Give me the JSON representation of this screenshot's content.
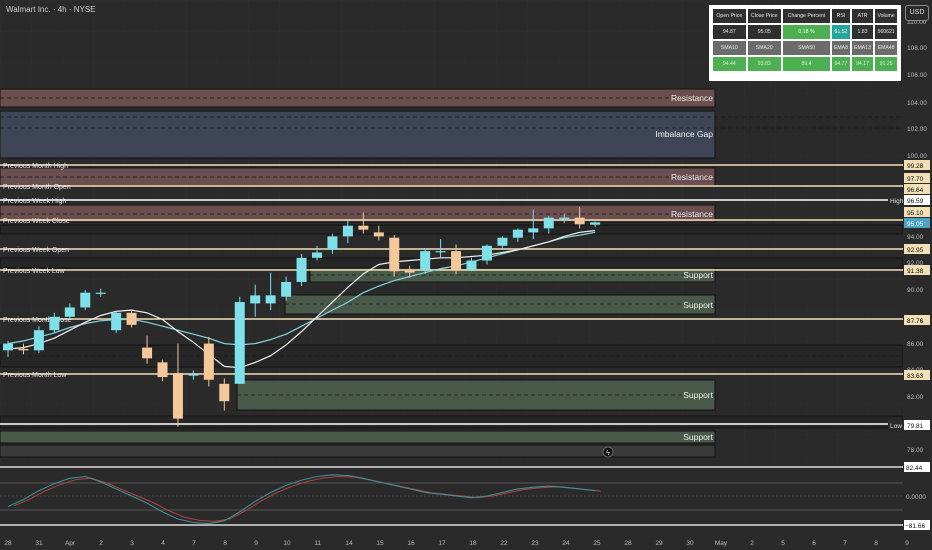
{
  "header": {
    "title": "Walmart Inc. · 4h · NYSE",
    "currency_button": "USD"
  },
  "stats_table": {
    "row1_headers": [
      "Open Price",
      "Close Price",
      "Change Percent",
      "RSI",
      "ATR",
      "Volume"
    ],
    "row1_values": [
      "94.87",
      "95.05",
      "0.18 %",
      "61.52",
      "1.83",
      "560621"
    ],
    "row2_headers": [
      "SMA10",
      "SMA20",
      "SMA50",
      "EMA8",
      "EMA13",
      "EMA48"
    ],
    "row2_values": [
      "94.44",
      "93.83",
      "89.4",
      "94.77",
      "94.17",
      "91.25"
    ]
  },
  "zone_labels": {
    "resistance_top": "Resistance",
    "imbalance": "Imbalance Gap",
    "resistance_mid": "Resistance",
    "resistance_low": "Resistance",
    "support_1": "Support",
    "support_2": "Support",
    "support_3": "Support",
    "support_4": "Support"
  },
  "level_labels": [
    "Previous Month High",
    "Previous Month Open",
    "Previous Week High",
    "Previous Week Close",
    "Previous Week Open",
    "Previous Week Low",
    "Previous Month Close",
    "Previous Month Low"
  ],
  "price_axis": [
    "108.00",
    "106.00",
    "104.00",
    "102.00",
    "100.00",
    "94.00",
    "92.00",
    "90.00",
    "88.00",
    "86.00",
    "84.00",
    "82.00",
    "78.00",
    "110.00"
  ],
  "price_tags": {
    "t9928": "99.28",
    "t9770": "97.70",
    "t9664": "96.64",
    "t9659": "96.59",
    "t9510": "95.10",
    "t9505": "95.05",
    "t9295": "92.95",
    "t9138": "91.38",
    "t8776": "87.76",
    "t8363": "83.63",
    "t7981": "79.81"
  },
  "high_label": "High",
  "low_label": "Low",
  "oscillator_axis": {
    "top": "82.44",
    "mid": "0.0000",
    "bottom": "−81.66"
  },
  "time_axis": [
    "28",
    "31",
    "Apr",
    "2",
    "3",
    "4",
    "7",
    "8",
    "9",
    "10",
    "11",
    "14",
    "15",
    "16",
    "17",
    "18",
    "22",
    "23",
    "24",
    "25",
    "28",
    "29",
    "30",
    "May",
    "2",
    "5",
    "6",
    "7",
    "8",
    "9"
  ],
  "colors": {
    "bull": "#7ee0e8",
    "bear": "#f5c89a",
    "resistance": "#6a4f4e",
    "support": "#4a5a4a",
    "imbalance": "#3e4556",
    "level_line": "#f3dfb6",
    "sma_fast": "#f0f0f0",
    "sma_slow": "#86d5dd"
  },
  "chart_data": {
    "type": "candlestick",
    "timeframe": "4h",
    "candles": [
      {
        "o": 85.5,
        "h": 86.2,
        "l": 85.0,
        "c": 86.0
      },
      {
        "o": 85.6,
        "h": 86.0,
        "l": 85.2,
        "c": 85.5
      },
      {
        "o": 85.5,
        "h": 87.3,
        "l": 85.3,
        "c": 87.0
      },
      {
        "o": 87.0,
        "h": 88.3,
        "l": 86.8,
        "c": 88.0
      },
      {
        "o": 88.0,
        "h": 89.0,
        "l": 87.8,
        "c": 88.7
      },
      {
        "o": 88.7,
        "h": 90.0,
        "l": 88.5,
        "c": 89.8
      },
      {
        "o": 89.8,
        "h": 90.1,
        "l": 89.5,
        "c": 89.8
      },
      {
        "o": 87.0,
        "h": 88.4,
        "l": 86.8,
        "c": 88.3
      },
      {
        "o": 88.3,
        "h": 88.5,
        "l": 87.2,
        "c": 87.4
      },
      {
        "o": 85.7,
        "h": 86.6,
        "l": 84.5,
        "c": 84.9
      },
      {
        "o": 84.6,
        "h": 84.8,
        "l": 83.2,
        "c": 83.5
      },
      {
        "o": 83.8,
        "h": 86.0,
        "l": 79.8,
        "c": 80.4
      },
      {
        "o": 83.7,
        "h": 84.0,
        "l": 83.3,
        "c": 83.7
      },
      {
        "o": 86.0,
        "h": 86.5,
        "l": 82.8,
        "c": 83.3
      },
      {
        "o": 83.0,
        "h": 83.4,
        "l": 81.0,
        "c": 81.7
      },
      {
        "o": 83.0,
        "h": 89.5,
        "l": 83.0,
        "c": 89.1
      },
      {
        "o": 89.0,
        "h": 90.4,
        "l": 88.0,
        "c": 89.6
      },
      {
        "o": 89.0,
        "h": 91.3,
        "l": 88.5,
        "c": 89.6
      },
      {
        "o": 89.5,
        "h": 91.0,
        "l": 89.2,
        "c": 90.6
      },
      {
        "o": 90.6,
        "h": 92.7,
        "l": 90.3,
        "c": 92.4
      },
      {
        "o": 92.4,
        "h": 93.3,
        "l": 92.2,
        "c": 92.8
      },
      {
        "o": 93.0,
        "h": 94.2,
        "l": 92.7,
        "c": 94.0
      },
      {
        "o": 94.0,
        "h": 95.3,
        "l": 93.5,
        "c": 94.8
      },
      {
        "o": 94.8,
        "h": 95.8,
        "l": 94.2,
        "c": 94.5
      },
      {
        "o": 94.3,
        "h": 94.8,
        "l": 93.7,
        "c": 94.0
      },
      {
        "o": 93.9,
        "h": 94.1,
        "l": 91.0,
        "c": 91.4
      },
      {
        "o": 91.5,
        "h": 91.8,
        "l": 90.9,
        "c": 91.3
      },
      {
        "o": 91.5,
        "h": 93.1,
        "l": 91.2,
        "c": 92.9
      },
      {
        "o": 92.9,
        "h": 93.8,
        "l": 92.4,
        "c": 92.9
      },
      {
        "o": 92.9,
        "h": 93.4,
        "l": 91.2,
        "c": 91.5
      },
      {
        "o": 91.5,
        "h": 92.4,
        "l": 91.4,
        "c": 92.2
      },
      {
        "o": 92.2,
        "h": 93.4,
        "l": 91.9,
        "c": 93.3
      },
      {
        "o": 93.3,
        "h": 94.0,
        "l": 93.0,
        "c": 93.9
      },
      {
        "o": 93.9,
        "h": 94.6,
        "l": 93.6,
        "c": 94.5
      },
      {
        "o": 94.3,
        "h": 96.0,
        "l": 93.8,
        "c": 94.6
      },
      {
        "o": 94.6,
        "h": 95.5,
        "l": 94.2,
        "c": 95.4
      },
      {
        "o": 95.3,
        "h": 95.7,
        "l": 95.0,
        "c": 95.4
      },
      {
        "o": 95.4,
        "h": 96.2,
        "l": 94.6,
        "c": 94.9
      },
      {
        "o": 94.87,
        "h": 95.1,
        "l": 94.7,
        "c": 95.05
      }
    ],
    "sma_fast": [
      85.6,
      85.7,
      86.0,
      86.4,
      87.0,
      87.6,
      88.1,
      88.4,
      88.5,
      88.3,
      87.8,
      86.9,
      86.1,
      85.2,
      84.3,
      84.2,
      84.6,
      85.1,
      85.9,
      86.9,
      88.0,
      89.1,
      90.2,
      91.2,
      91.9,
      92.1,
      92.2,
      92.3,
      92.4,
      92.4,
      92.5,
      92.6,
      92.8,
      93.0,
      93.3,
      93.6,
      94.0,
      94.3,
      94.44
    ],
    "sma_slow": [
      86.0,
      86.2,
      86.5,
      86.8,
      87.2,
      87.5,
      87.7,
      87.8,
      87.8,
      87.6,
      87.3,
      87.0,
      86.7,
      86.4,
      86.0,
      85.9,
      86.0,
      86.3,
      86.7,
      87.3,
      87.9,
      88.5,
      89.1,
      89.8,
      90.3,
      90.7,
      91.0,
      91.3,
      91.6,
      91.8,
      92.1,
      92.4,
      92.7,
      93.0,
      93.3,
      93.6,
      93.9,
      94.1,
      94.3
    ],
    "oscillator": [
      -30,
      -10,
      15,
      35,
      50,
      55,
      40,
      20,
      0,
      -20,
      -45,
      -65,
      -75,
      -78,
      -70,
      -45,
      -15,
      10,
      30,
      45,
      55,
      60,
      58,
      50,
      40,
      30,
      20,
      10,
      5,
      0,
      -5,
      0,
      10,
      20,
      25,
      28,
      25,
      20,
      15
    ],
    "levels": {
      "previous_month_high": 99.28,
      "previous_month_open": 97.7,
      "previous_week_high": 96.59,
      "previous_week_close": 95.1,
      "previous_week_open": 92.95,
      "previous_week_low": 91.38,
      "previous_month_close": 87.76,
      "previous_month_low": 83.63,
      "period_low": 79.81
    },
    "oscillator_range": [
      -81.66,
      82.44
    ]
  }
}
